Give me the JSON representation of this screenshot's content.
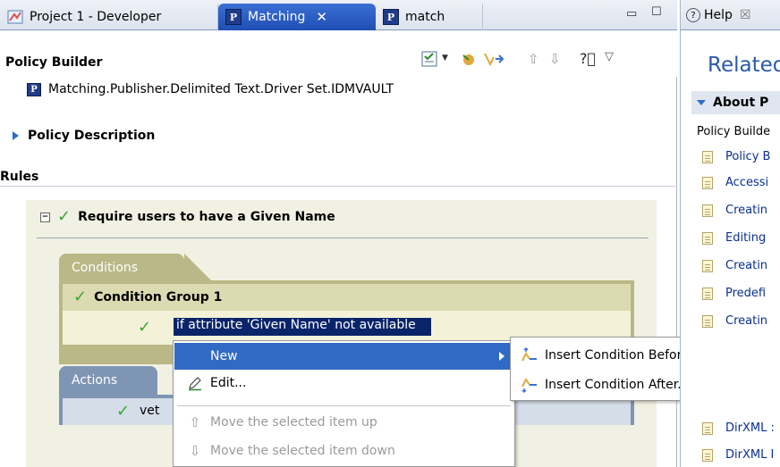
{
  "editor": {
    "tabs": [
      {
        "label": "Project 1 - Developer"
      },
      {
        "label": "Matching",
        "close": "✕"
      },
      {
        "label": "match"
      }
    ],
    "panel_title": "Policy Builder",
    "policy_path": "Matching.Publisher.Delimited Text.Driver Set.IDMVAULT",
    "policy_description_label": "Policy Description",
    "rules_label": "Rules",
    "rule": {
      "name": "Require users to have a Given Name",
      "conditions_tab": "Conditions",
      "condition_group": "Condition Group 1",
      "condition_text": "if attribute 'Given Name' not available",
      "actions_tab": "Actions",
      "action_text": "vet"
    }
  },
  "context_menu": {
    "items": [
      {
        "label": "New",
        "enabled": true
      },
      {
        "label": "Edit...",
        "enabled": true
      },
      {
        "label": "Move the selected item up",
        "enabled": false
      },
      {
        "label": "Move the selected item down",
        "enabled": false
      }
    ],
    "submenu": [
      {
        "label": "Insert Condition Before..."
      },
      {
        "label": "Insert Condition After..."
      }
    ]
  },
  "help": {
    "tab_label": "Help",
    "tab_close": "☒",
    "related_title": "Related",
    "section": "About P",
    "description": "Policy Builde",
    "links": [
      "Policy B",
      "Accessi",
      "Creatin",
      "Editing ",
      "Creatin",
      "Predefi",
      "Creatin",
      "DirXML :",
      "DirXML I"
    ]
  },
  "colors": {
    "active_tab": "#2554c0",
    "selection": "#0a246a",
    "menu_highlight": "#316ac5",
    "conditions_olive": "#b9b886",
    "actions_blue": "#7e95b3",
    "check_green": "#3aa536",
    "help_title_blue": "#2a5aa8"
  }
}
